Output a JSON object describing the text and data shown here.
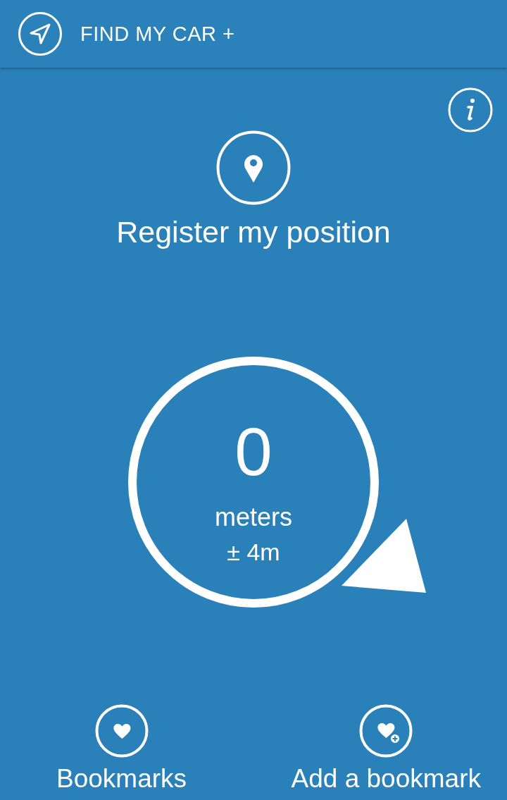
{
  "app_bar": {
    "title": "FIND MY CAR +"
  },
  "register": {
    "label": "Register my position"
  },
  "distance": {
    "value": "0",
    "unit": "meters",
    "accuracy": "± 4m"
  },
  "actions": [
    {
      "kind": "bookmarks",
      "label": "Bookmarks"
    },
    {
      "kind": "add_bookmark",
      "label": "Add a bookmark"
    }
  ]
}
